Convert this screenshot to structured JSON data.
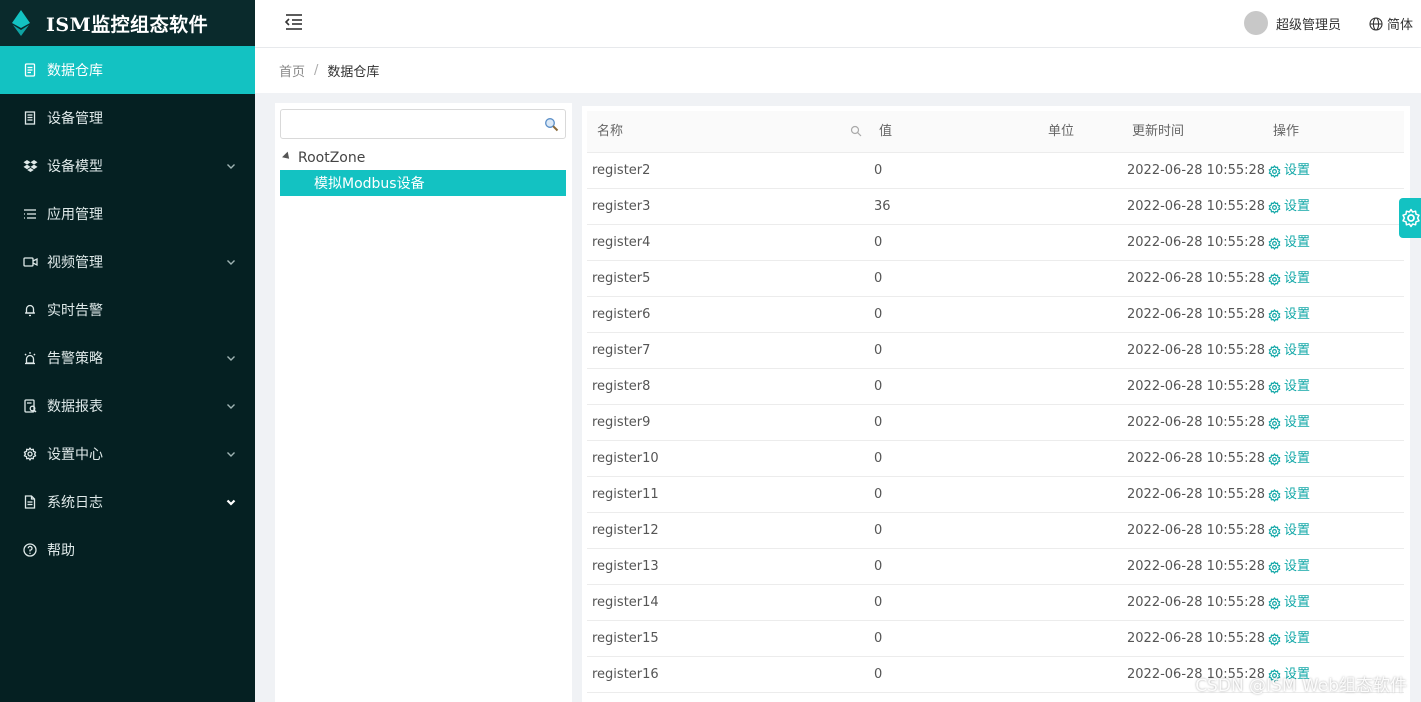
{
  "brand": {
    "title": "ISM监控组态软件",
    "logo_icon": "diamond-logo-icon",
    "accent": "#13c2c2"
  },
  "sidebar": {
    "items": [
      {
        "label": "数据仓库",
        "icon": "document-icon",
        "active": true,
        "expandable": false
      },
      {
        "label": "设备管理",
        "icon": "device-icon",
        "active": false,
        "expandable": false
      },
      {
        "label": "设备模型",
        "icon": "dropbox-icon",
        "active": false,
        "expandable": true
      },
      {
        "label": "应用管理",
        "icon": "list-icon",
        "active": false,
        "expandable": false
      },
      {
        "label": "视频管理",
        "icon": "video-icon",
        "active": false,
        "expandable": true
      },
      {
        "label": "实时告警",
        "icon": "bell-icon",
        "active": false,
        "expandable": false
      },
      {
        "label": "告警策略",
        "icon": "alarm-icon",
        "active": false,
        "expandable": true
      },
      {
        "label": "数据报表",
        "icon": "report-icon",
        "active": false,
        "expandable": true
      },
      {
        "label": "设置中心",
        "icon": "gear-icon",
        "active": false,
        "expandable": true
      },
      {
        "label": "系统日志",
        "icon": "log-icon",
        "active": false,
        "expandable": true
      },
      {
        "label": "帮助",
        "icon": "help-icon",
        "active": false,
        "expandable": false
      }
    ]
  },
  "header": {
    "user_name": "超级管理员",
    "language": "简体"
  },
  "breadcrumb": {
    "home": "首页",
    "separator": "/",
    "current": "数据仓库"
  },
  "tree": {
    "search_placeholder": "",
    "root_label": "RootZone",
    "selected_node": "模拟Modbus设备"
  },
  "table": {
    "columns": {
      "name": "名称",
      "value": "值",
      "unit": "单位",
      "updated": "更新时间",
      "action": "操作"
    },
    "rows": [
      {
        "name": "register2",
        "value": "0",
        "unit": "",
        "updated": "2022-06-28 10:55:28",
        "action": "设置"
      },
      {
        "name": "register3",
        "value": "36",
        "unit": "",
        "updated": "2022-06-28 10:55:28",
        "action": "设置"
      },
      {
        "name": "register4",
        "value": "0",
        "unit": "",
        "updated": "2022-06-28 10:55:28",
        "action": "设置"
      },
      {
        "name": "register5",
        "value": "0",
        "unit": "",
        "updated": "2022-06-28 10:55:28",
        "action": "设置"
      },
      {
        "name": "register6",
        "value": "0",
        "unit": "",
        "updated": "2022-06-28 10:55:28",
        "action": "设置"
      },
      {
        "name": "register7",
        "value": "0",
        "unit": "",
        "updated": "2022-06-28 10:55:28",
        "action": "设置"
      },
      {
        "name": "register8",
        "value": "0",
        "unit": "",
        "updated": "2022-06-28 10:55:28",
        "action": "设置"
      },
      {
        "name": "register9",
        "value": "0",
        "unit": "",
        "updated": "2022-06-28 10:55:28",
        "action": "设置"
      },
      {
        "name": "register10",
        "value": "0",
        "unit": "",
        "updated": "2022-06-28 10:55:28",
        "action": "设置"
      },
      {
        "name": "register11",
        "value": "0",
        "unit": "",
        "updated": "2022-06-28 10:55:28",
        "action": "设置"
      },
      {
        "name": "register12",
        "value": "0",
        "unit": "",
        "updated": "2022-06-28 10:55:28",
        "action": "设置"
      },
      {
        "name": "register13",
        "value": "0",
        "unit": "",
        "updated": "2022-06-28 10:55:28",
        "action": "设置"
      },
      {
        "name": "register14",
        "value": "0",
        "unit": "",
        "updated": "2022-06-28 10:55:28",
        "action": "设置"
      },
      {
        "name": "register15",
        "value": "0",
        "unit": "",
        "updated": "2022-06-28 10:55:28",
        "action": "设置"
      },
      {
        "name": "register16",
        "value": "0",
        "unit": "",
        "updated": "2022-06-28 10:55:28",
        "action": "设置"
      }
    ]
  },
  "watermark": "CSDN @ISM Web组态软件"
}
